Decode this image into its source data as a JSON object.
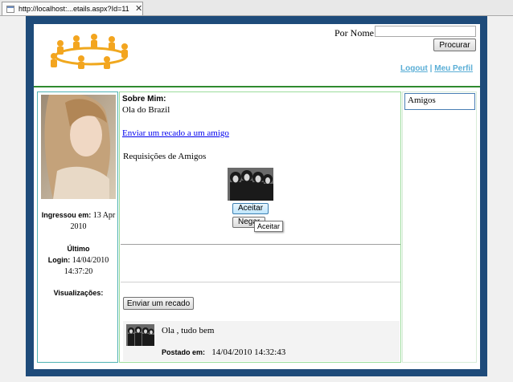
{
  "browser": {
    "tab_title": "http://localhost:...etails.aspx?Id=11",
    "tab_close": "✕"
  },
  "header": {
    "search_label": "Por Nome:",
    "search_value": "",
    "search_button": "Procurar",
    "logout_link": "Logout",
    "link_separator": " | ",
    "profile_link": "Meu Perfil"
  },
  "profile": {
    "joined_label": "Ingressou em:",
    "joined_value": "13 Apr 2010",
    "last_login_label_1": "Último",
    "last_login_label_2": "Login:",
    "last_login_value": "14/04/2010 14:37:20",
    "views_label": "Visualizações:"
  },
  "main": {
    "about_heading": "Sobre Mim:",
    "about_text": "Ola do Brazil",
    "send_message_link": "Enviar um recado a um amigo",
    "requests_title": "Requisições de Amigos",
    "accept_button": "Aceitar",
    "reject_button": "Negar",
    "tooltip": "Aceitar",
    "send_scrap_button": "Enviar um recado",
    "scrap": {
      "text": "Ola , tudo bem",
      "posted_label": "Postado em:",
      "posted_value": "14/04/2010 14:32:43"
    }
  },
  "sidebar": {
    "friends_title": "Amigos"
  }
}
